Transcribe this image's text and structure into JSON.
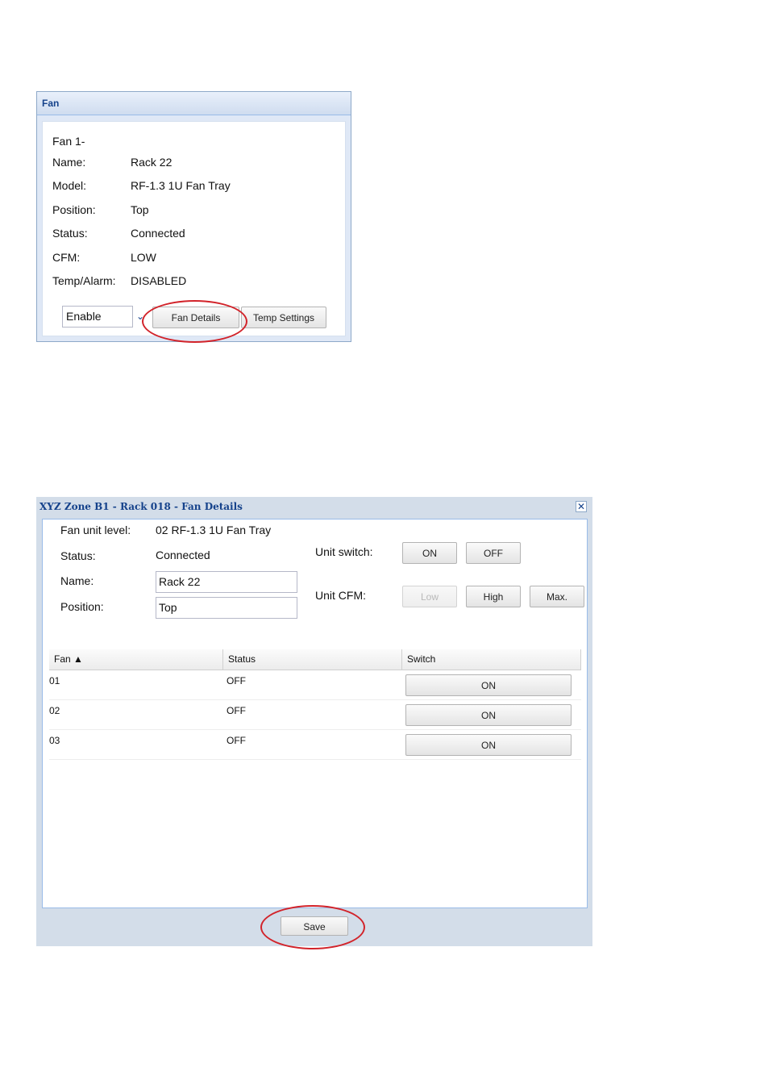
{
  "fan_panel": {
    "title": "Fan",
    "heading": "Fan 1-",
    "rows": [
      {
        "label": "Name:",
        "value": "Rack 22"
      },
      {
        "label": "Model:",
        "value": "RF-1.3 1U Fan Tray"
      },
      {
        "label": "Position:",
        "value": "Top"
      },
      {
        "label": "Status:",
        "value": "Connected"
      },
      {
        "label": "CFM:",
        "value": "LOW"
      },
      {
        "label": "Temp/Alarm:",
        "value": "DISABLED"
      }
    ],
    "enable_select": "Enable",
    "fan_details_button": "Fan Details",
    "temp_settings_button": "Temp Settings"
  },
  "details_window": {
    "title": "XYZ Zone B1 - Rack 018 - Fan Details",
    "close_icon": "✕",
    "fan_unit_level_label": "Fan unit level:",
    "fan_unit_level_value": "02 RF-1.3 1U Fan Tray",
    "status_label": "Status:",
    "status_value": "Connected",
    "name_label": "Name:",
    "name_value": "Rack 22",
    "position_label": "Position:",
    "position_value": "Top",
    "unit_switch_label": "Unit switch:",
    "unit_switch_on": "ON",
    "unit_switch_off": "OFF",
    "unit_cfm_label": "Unit CFM:",
    "cfm_low": "Low",
    "cfm_high": "High",
    "cfm_max": "Max.",
    "grid": {
      "columns": [
        "Fan ▲",
        "Status",
        "Switch"
      ],
      "rows": [
        {
          "fan": "01",
          "status": "OFF",
          "switch": "ON"
        },
        {
          "fan": "02",
          "status": "OFF",
          "switch": "ON"
        },
        {
          "fan": "03",
          "status": "OFF",
          "switch": "ON"
        }
      ]
    },
    "save_button": "Save"
  },
  "colors": {
    "accent_title": "#15428b",
    "highlight_circle": "#d2232a",
    "window_frame": "#d3dde9"
  }
}
